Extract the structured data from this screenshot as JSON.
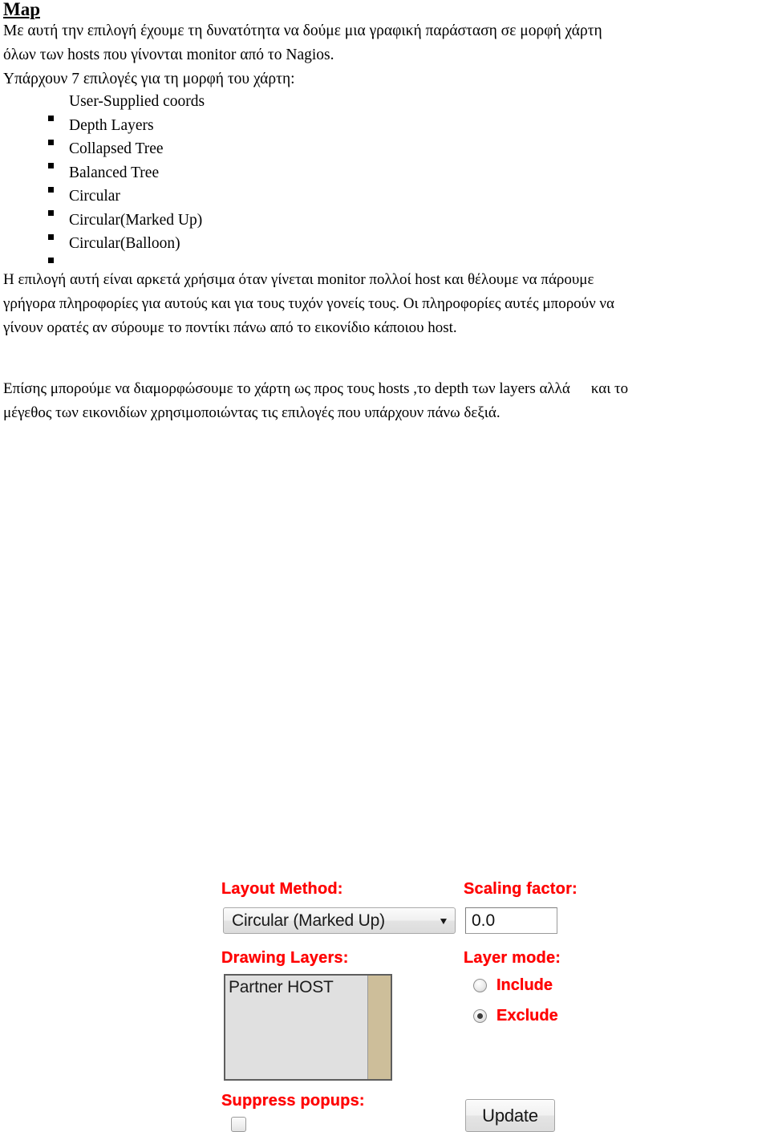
{
  "document": {
    "title": "Map",
    "intro_lines": [
      "Με αυτή την επιλογή έχουμε τη δυνατότητα να δούμε μια γραφική παράσταση σε μορφή χάρτη",
      "όλων των hosts που γίνονται monitor από το Nagios.",
      "Υπάρχουν 7 επιλογές για τη μορφή του χάρτη:"
    ],
    "map_options": [
      {
        "label": "User-Supplied coords"
      },
      {
        "label": "Depth Layers"
      },
      {
        "label": "Collapsed Tree"
      },
      {
        "label": "Balanced Tree"
      },
      {
        "label": "Circular"
      },
      {
        "label": "Circular(Marked Up)"
      },
      {
        "label": "Circular(Balloon)"
      }
    ],
    "paragraph_1_lines": [
      "Η επιλογή αυτή είναι αρκετά χρήσιμα όταν γίνεται monitor πολλοί host και θέλουμε να πάρουμε",
      "γρήγορα πληροφορίες για αυτούς και για τους τυχόν γονείς τους. Οι πληροφορίες αυτές μπορούν να",
      "γίνουν ορατές αν σύρουμε το ποντίκι πάνω από το εικονίδιο κάποιου host."
    ],
    "paragraph_2_lines": [
      "Επίσης μπορούμε να διαμορφώσουμε το χάρτη ως προς τους hosts ,το depth των layers αλλά",
      "και το",
      "μέγεθος των εικονιδίων χρησιμοποιώντας τις επιλογές που υπάρχουν πάνω δεξιά."
    ]
  },
  "form": {
    "layout_method": {
      "label": "Layout Method:",
      "value": "Circular (Marked Up)",
      "arrow_icon": "chevron-down-icon"
    },
    "scaling_factor": {
      "label": "Scaling factor:",
      "value": "0.0"
    },
    "drawing_layers": {
      "label": "Drawing Layers:",
      "items": [
        "Partner HOST"
      ]
    },
    "layer_mode": {
      "label": "Layer mode:",
      "options": [
        {
          "label": "Include",
          "selected": false
        },
        {
          "label": "Exclude",
          "selected": true
        }
      ]
    },
    "suppress_popups": {
      "label": "Suppress popups:",
      "checked": false
    },
    "update_button": {
      "label": "Update"
    },
    "colors": {
      "label_red": "#ff0000",
      "listbox_scrollbar": "#cdbe9a",
      "listbox_background": "#e0e0e0"
    }
  }
}
